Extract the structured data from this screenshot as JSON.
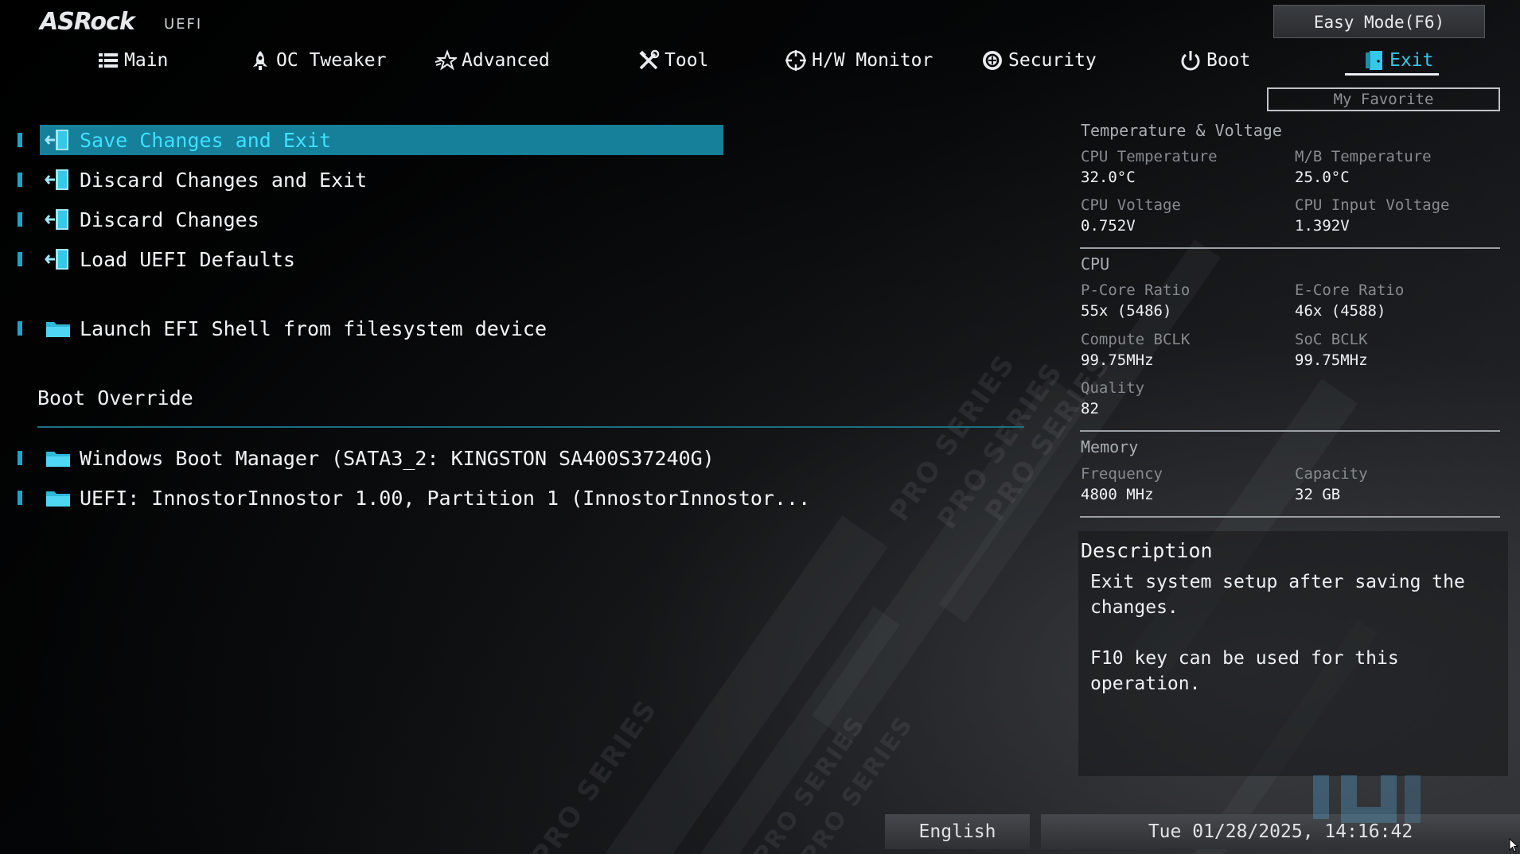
{
  "header": {
    "brand": "ASRock",
    "brand_sub": "UEFI",
    "easy_mode": "Easy Mode(F6)",
    "my_favorite": "My Favorite"
  },
  "tabs": [
    {
      "label": "Main",
      "icon": "list-icon",
      "active": false
    },
    {
      "label": "OC Tweaker",
      "icon": "rocket-icon",
      "active": false
    },
    {
      "label": "Advanced",
      "icon": "star-icon",
      "active": false
    },
    {
      "label": "Tool",
      "icon": "tools-icon",
      "active": false
    },
    {
      "label": "H/W Monitor",
      "icon": "crosshair-icon",
      "active": false
    },
    {
      "label": "Security",
      "icon": "shield-icon",
      "active": false
    },
    {
      "label": "Boot",
      "icon": "power-icon",
      "active": false
    },
    {
      "label": "Exit",
      "icon": "exit-door-icon",
      "active": true
    }
  ],
  "menu": {
    "items": [
      {
        "label": "Save Changes and Exit",
        "icon": "exit-door-icon",
        "selected": true
      },
      {
        "label": "Discard Changes and Exit",
        "icon": "exit-door-icon",
        "selected": false
      },
      {
        "label": "Discard Changes",
        "icon": "exit-door-icon",
        "selected": false
      },
      {
        "label": "Load UEFI Defaults",
        "icon": "exit-door-icon",
        "selected": false
      },
      {
        "label": "Launch EFI Shell from filesystem device",
        "icon": "folder-icon",
        "selected": false
      }
    ],
    "boot_override_title": "Boot Override",
    "boot_override_items": [
      {
        "label": "Windows Boot Manager (SATA3_2: KINGSTON SA400S37240G)",
        "icon": "folder-icon"
      },
      {
        "label": "UEFI: InnostorInnostor 1.00, Partition 1 (InnostorInnostor...",
        "icon": "folder-icon"
      }
    ]
  },
  "monitor": {
    "temp_voltage_title": "Temperature & Voltage",
    "cpu_temp_label": "CPU Temperature",
    "cpu_temp": "32.0°C",
    "mb_temp_label": "M/B Temperature",
    "mb_temp": "25.0°C",
    "cpu_voltage_label": "CPU Voltage",
    "cpu_voltage": "0.752V",
    "cpu_input_voltage_label": "CPU Input Voltage",
    "cpu_input_voltage": "1.392V",
    "cpu_title": "CPU",
    "pcore_label": "P-Core Ratio",
    "pcore": "55x (5486)",
    "ecore_label": "E-Core Ratio",
    "ecore": "46x (4588)",
    "compute_bclk_label": "Compute BCLK",
    "compute_bclk": "99.75MHz",
    "soc_bclk_label": "SoC BCLK",
    "soc_bclk": "99.75MHz",
    "quality_label": "Quality",
    "quality": "82",
    "memory_title": "Memory",
    "frequency_label": "Frequency",
    "frequency": "4800 MHz",
    "capacity_label": "Capacity",
    "capacity": "32 GB"
  },
  "description": {
    "title": "Description",
    "text": "Exit system setup after saving the\nchanges.\n\nF10 key can be used for this operation."
  },
  "footer": {
    "language": "English",
    "datetime": "Tue 01/28/2025, 14:16:42"
  },
  "colors": {
    "accent": "#35c8e8",
    "selection": "#167f9a",
    "marker": "#1aa6c8"
  }
}
